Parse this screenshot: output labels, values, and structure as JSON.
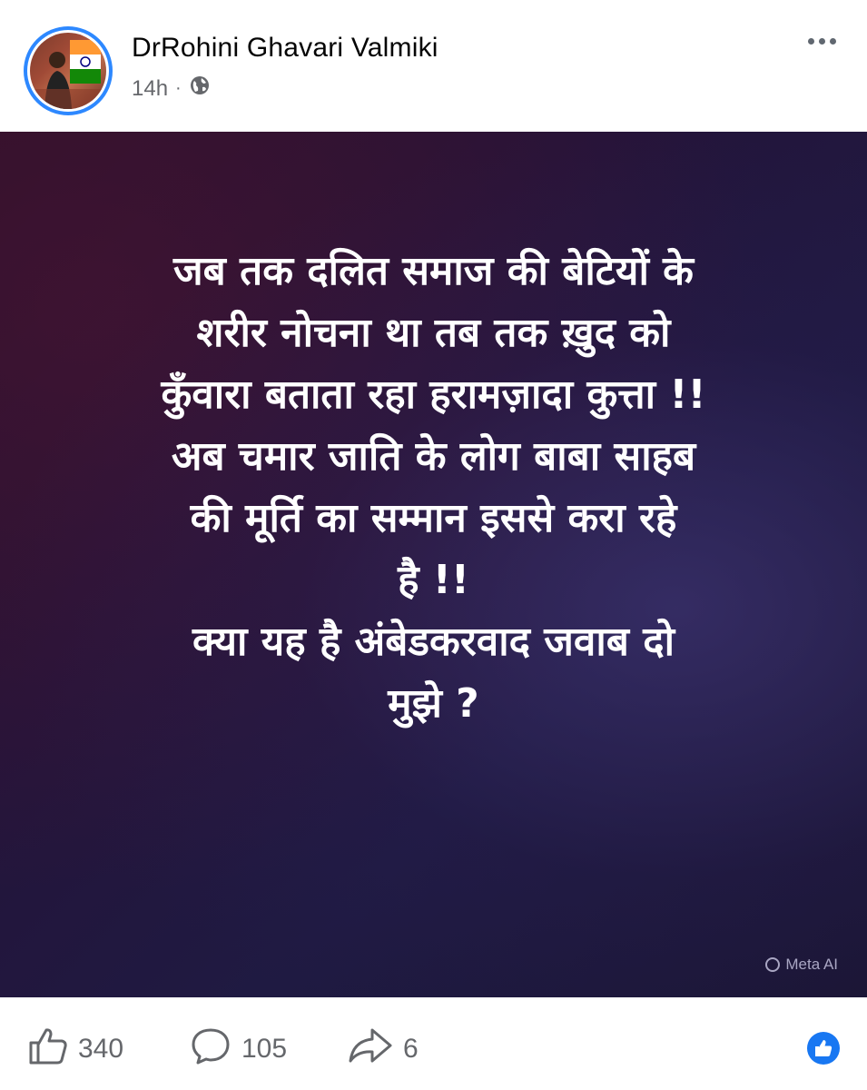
{
  "post": {
    "author": "DrRohini Ghavari Valmiki",
    "time": "14h",
    "separator": "·",
    "lines": [
      "जब तक दलित समाज की बेटियों के",
      "शरीर नोचना था तब तक ख़ुद को",
      "कुँवारा बताता रहा हरामज़ादा कुत्ता !!",
      "अब चमार जाति के लोग बाबा साहब",
      "की मूर्ति का सम्मान इससे करा रहे",
      "है !!",
      "क्या यह है अंबेडकरवाद जवाब दो",
      "मुझे ?"
    ],
    "watermark": "Meta AI",
    "background_colors": [
      "#2a0f28",
      "#24143a",
      "#1f1a42"
    ]
  },
  "actions": {
    "likes": "340",
    "comments": "105",
    "shares": "6"
  },
  "icons": {
    "privacy": "globe-icon",
    "more": "more-options-icon",
    "like": "thumbs-up-icon",
    "comment": "comment-bubble-icon",
    "share": "share-arrow-icon",
    "reaction": "like-reaction-icon"
  },
  "colors": {
    "accent": "#1877f2",
    "ring": "#2d88ff",
    "secondary_text": "#65676b"
  }
}
